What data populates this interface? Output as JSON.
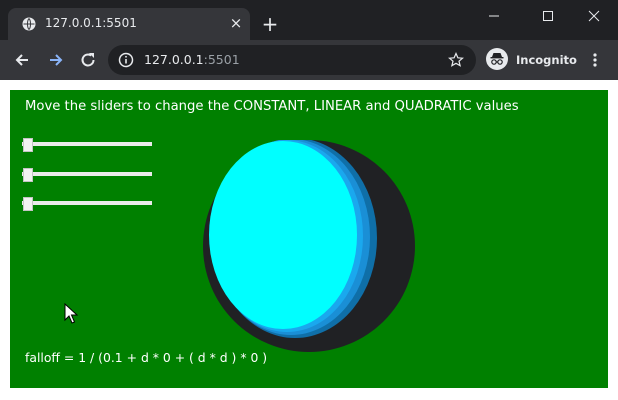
{
  "browser": {
    "tab": {
      "title": "127.0.0.1:5501",
      "close_glyph": "×"
    },
    "new_tab_glyph": "+",
    "url": {
      "host": "127.0.0.1",
      "port": ":5501"
    },
    "profile_label": "Incognito",
    "icons": {
      "favicon": "globe-icon",
      "back": "back-arrow-icon",
      "forward": "forward-arrow-icon",
      "reload": "reload-icon",
      "info": "info-icon",
      "bookmark": "star-icon",
      "incognito": "incognito-icon",
      "menu": "kebab-menu-icon",
      "minimize": "minimize-icon",
      "maximize": "maximize-icon",
      "close": "close-icon"
    }
  },
  "page": {
    "background": "#008000",
    "instructions": "Move the sliders to change the CONSTANT, LINEAR and QUADRATIC values",
    "sliders": [
      {
        "name": "constant",
        "value": 0
      },
      {
        "name": "linear",
        "value": 0
      },
      {
        "name": "quadratic",
        "value": 0
      }
    ],
    "formula": "falloff = 1 / (0.1 + d * 0 + ( d * d ) * 0 )",
    "sphere": {
      "lit_color": "#00ffff",
      "mid_color": "#1aa8ee",
      "shadow_color": "#202124"
    }
  }
}
